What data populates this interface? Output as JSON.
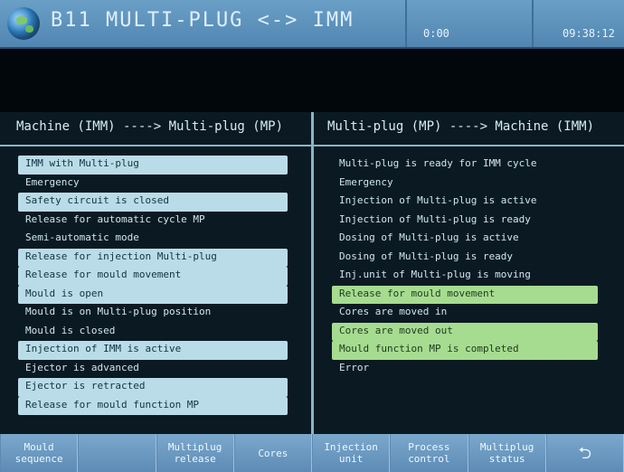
{
  "header": {
    "title": "B11 MULTI-PLUG <-> IMM",
    "time_left": "0:00",
    "time_right": "09:38:12"
  },
  "left_panel": {
    "title": "Machine (IMM)  ----> Multi-plug (MP)",
    "rows": [
      {
        "text": "IMM with Multi-plug",
        "hl": "blue"
      },
      {
        "text": "Emergency",
        "hl": ""
      },
      {
        "text": "Safety circuit is closed",
        "hl": "blue"
      },
      {
        "text": "Release for automatic cycle MP",
        "hl": ""
      },
      {
        "text": "Semi-automatic mode",
        "hl": ""
      },
      {
        "text": "Release for injection Multi-plug",
        "hl": "blue"
      },
      {
        "text": "Release for mould movement",
        "hl": "blue"
      },
      {
        "text": "Mould is open",
        "hl": "blue"
      },
      {
        "text": "Mould is on Multi-plug position",
        "hl": ""
      },
      {
        "text": "Mould is closed",
        "hl": ""
      },
      {
        "text": "Injection of IMM is active",
        "hl": "blue"
      },
      {
        "text": "Ejector is advanced",
        "hl": ""
      },
      {
        "text": "Ejector is retracted",
        "hl": "blue"
      },
      {
        "text": "Release for mould function MP",
        "hl": "blue"
      }
    ]
  },
  "right_panel": {
    "title": "Multi-plug (MP) ----> Machine (IMM)",
    "rows": [
      {
        "text": "Multi-plug is ready for IMM cycle",
        "hl": ""
      },
      {
        "text": "Emergency",
        "hl": ""
      },
      {
        "text": "Injection of Multi-plug is active",
        "hl": ""
      },
      {
        "text": "Injection of Multi-plug is ready",
        "hl": ""
      },
      {
        "text": "Dosing of Multi-plug is active",
        "hl": ""
      },
      {
        "text": "Dosing of Multi-plug is ready",
        "hl": ""
      },
      {
        "text": "Inj.unit of Multi-plug is moving",
        "hl": ""
      },
      {
        "text": "Release for mould movement",
        "hl": "green"
      },
      {
        "text": "Cores are moved in",
        "hl": ""
      },
      {
        "text": "Cores are moved out",
        "hl": "green"
      },
      {
        "text": "Mould function MP is completed",
        "hl": "green"
      },
      {
        "text": "Error",
        "hl": ""
      }
    ]
  },
  "bottom_buttons": [
    {
      "label": "Mould\nsequence"
    },
    {
      "label": ""
    },
    {
      "label": "Multiplug\nrelease"
    },
    {
      "label": "Cores"
    },
    {
      "label": "Injection\nunit"
    },
    {
      "label": "Process\ncontrol"
    },
    {
      "label": "Multiplug\nstatus"
    },
    {
      "label": "⮌"
    }
  ],
  "colors": {
    "header": "#5f91bb",
    "bg": "#0b1a22",
    "highlight_blue": "#b9dce8",
    "highlight_green": "#a6dc90"
  }
}
